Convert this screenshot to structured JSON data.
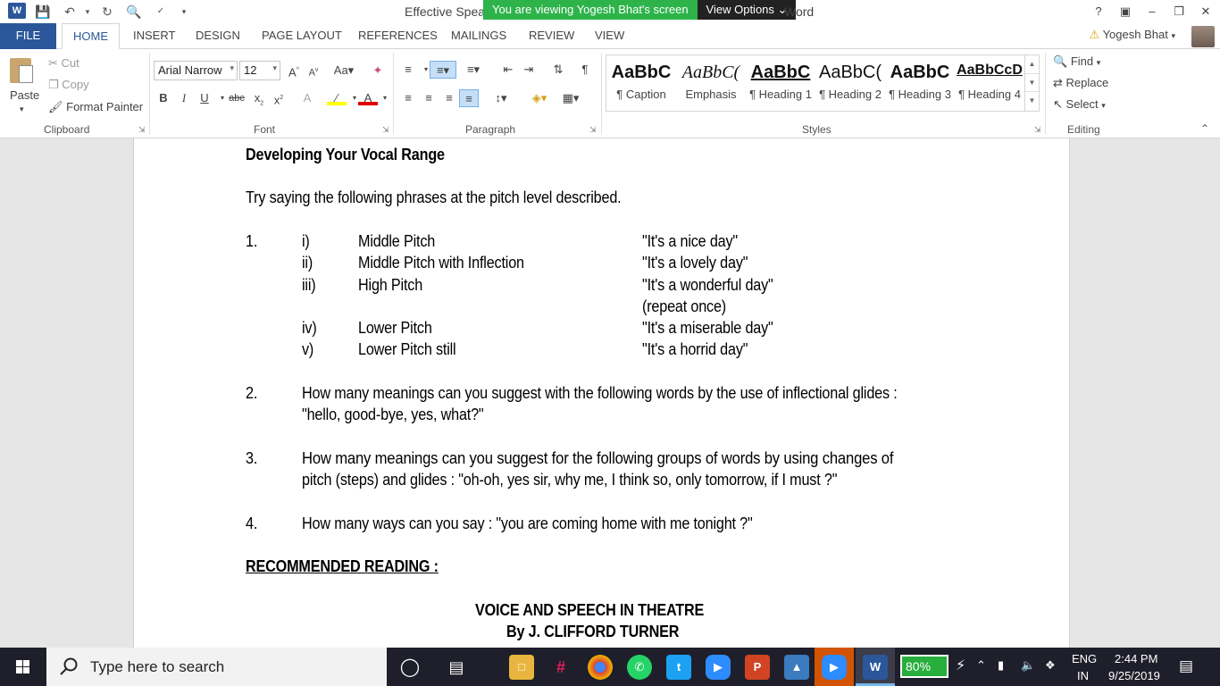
{
  "titlebar": {
    "doc_title": "Effective Speak",
    "doc_title_end": "Word",
    "share_banner": "You are viewing Yogesh Bhat's screen",
    "view_options": "View Options",
    "help": "?"
  },
  "tabs": [
    "FILE",
    "HOME",
    "INSERT",
    "DESIGN",
    "PAGE LAYOUT",
    "REFERENCES",
    "MAILINGS",
    "REVIEW",
    "VIEW"
  ],
  "user": {
    "name": "Yogesh Bhat"
  },
  "clipboard": {
    "paste": "Paste",
    "cut": "Cut",
    "copy": "Copy",
    "format_painter": "Format Painter",
    "label": "Clipboard"
  },
  "font": {
    "family": "Arial Narrow",
    "size": "12",
    "label": "Font"
  },
  "paragraph": {
    "label": "Paragraph"
  },
  "styles": {
    "label": "Styles",
    "items": [
      {
        "sample": "AaBbC",
        "name": "¶ Caption"
      },
      {
        "sample": "AaBbC(",
        "name": "Emphasis"
      },
      {
        "sample": "AaBbC",
        "name": "¶ Heading 1"
      },
      {
        "sample": "AaBbC(",
        "name": "¶ Heading 2"
      },
      {
        "sample": "AaBbC",
        "name": "¶ Heading 3"
      },
      {
        "sample": "AaBbCcD",
        "name": "¶ Heading 4"
      }
    ]
  },
  "editing": {
    "find": "Find",
    "replace": "Replace",
    "select": "Select",
    "label": "Editing"
  },
  "document": {
    "heading": "Developing Your Vocal Range",
    "intro": "Try saying the following phrases at the pitch level described.",
    "q1_num": "1.",
    "pitch_items": [
      {
        "roman": "i)",
        "label": "Middle Pitch",
        "phrase": "\"It's a nice day\""
      },
      {
        "roman": "ii)",
        "label": "Middle Pitch with Inflection",
        "phrase": "\"It's a lovely day\""
      },
      {
        "roman": "iii)",
        "label": "High Pitch",
        "phrase": "\"It's a wonderful day\""
      },
      {
        "roman": "iv)",
        "label": "Lower Pitch",
        "phrase": "\"It's a  miserable day\""
      },
      {
        "roman": "v)",
        "label": "Lower Pitch still",
        "phrase": "\"It's a horrid day\""
      }
    ],
    "repeat_note": "(repeat once)",
    "q2_num": "2.",
    "q2_line1": "How many meanings can you suggest with the following words by the use of inflectional glides :",
    "q2_line2": "\"hello, good-bye, yes, what?\"",
    "q3_num": "3.",
    "q3_line1": "How many meanings can you suggest for the following groups of words by using changes of",
    "q3_line2": "pitch (steps) and glides : \"oh-oh, yes sir, why me, I think so, only tomorrow, if I must ?\"",
    "q4_num": "4.",
    "q4_line": "How many ways can you say : \"you are coming home with me tonight ?\"",
    "reading_heading": "RECOMMENDED READING :",
    "book_title": "VOICE AND SPEECH IN THEATRE",
    "book_author": "By J. CLIFFORD TURNER"
  },
  "taskbar": {
    "search_placeholder": "Type here to search",
    "battery": "80%",
    "lang1": "ENG",
    "lang2": "IN",
    "time": "2:44 PM",
    "date": "9/25/2019"
  },
  "colors": {
    "word_blue": "#2b579a",
    "share_green": "#2db34a",
    "taskbar": "#1f1f2b"
  }
}
